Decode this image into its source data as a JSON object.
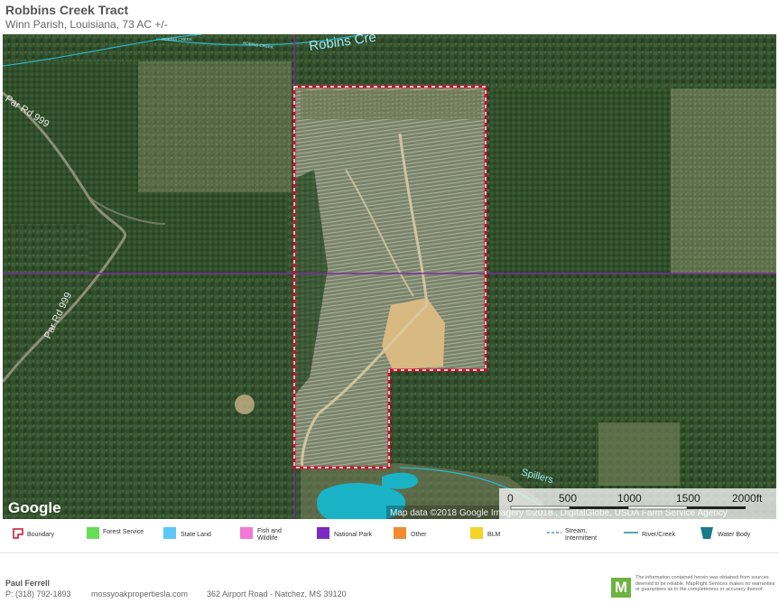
{
  "header": {
    "title": "Robbins Creek Tract",
    "subtitle": "Winn Parish, Louisiana, 73 AC +/-"
  },
  "map": {
    "labels": {
      "creek_north": "Robins Cre",
      "creek_small_1": "ROBINS CREEK",
      "creek_small_2": "ROBINS CREEK",
      "road_1": "Par Rd 999",
      "road_2": "Par Rd 999",
      "creek_south": "Spillers"
    },
    "attribution": "Map data ©2018 Google Imagery ©2018 , DigitalGlobe, USDA Farm Service Agency",
    "google_logo": "Google",
    "scale": {
      "ticks": [
        "0",
        "500",
        "1000",
        "1500",
        "2000ft"
      ]
    },
    "colors": {
      "boundary": "#c8102e",
      "water": "#1ab3c6",
      "parish_line": "#7a2c9e",
      "creek_line": "#2bb7c8"
    }
  },
  "legend": {
    "items": [
      {
        "label": "Boundary",
        "icon": "boundary-icon",
        "color": "#c8102e"
      },
      {
        "label": "Forest Service",
        "icon": "forest-service-swatch",
        "color": "#66dd55"
      },
      {
        "label": "State Land",
        "icon": "state-land-swatch",
        "color": "#5bc8f5"
      },
      {
        "label": "Fish and Wildlife",
        "icon": "fish-wildlife-swatch",
        "color": "#f27ad6"
      },
      {
        "label": "National Park",
        "icon": "national-park-swatch",
        "color": "#7a2cc2"
      },
      {
        "label": "Other",
        "icon": "other-swatch",
        "color": "#f28a2e"
      },
      {
        "label": "BLM",
        "icon": "blm-swatch",
        "color": "#f5d327"
      },
      {
        "label": "Stream, Intermittent",
        "icon": "stream-intermittent-icon",
        "color": "#2a7fc4"
      },
      {
        "label": "River/Creek",
        "icon": "river-creek-icon",
        "color": "#1a8a98"
      },
      {
        "label": "Water Body",
        "icon": "water-body-icon",
        "color": "#1a7a86"
      }
    ]
  },
  "footer": {
    "agent_name": "Paul Ferrell",
    "phone": "P: (318) 792-1893",
    "website": "mossyoakpropertiesla.com",
    "address": "362 Airport Road - Natchez, MS 39120",
    "logo_letter": "M",
    "disclaimer": "The information contained herein was obtained from sources deemed to be reliable. MapRight Services makes no warranties or guarantees as to the completeness or accuracy thereof."
  }
}
